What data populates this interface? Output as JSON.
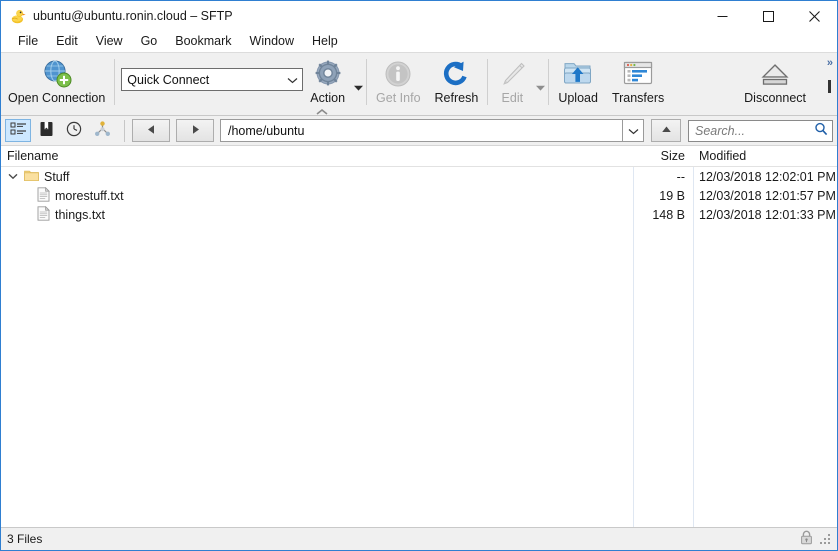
{
  "window": {
    "title": "ubuntu@ubuntu.ronin.cloud – SFTP",
    "app_icon": "duck-icon",
    "accent_color": "#2f7fd1",
    "controls": {
      "minimize": "minimize-icon",
      "maximize": "maximize-icon",
      "close": "close-icon"
    }
  },
  "menubar": {
    "items": [
      {
        "label": "File"
      },
      {
        "label": "Edit"
      },
      {
        "label": "View"
      },
      {
        "label": "Go"
      },
      {
        "label": "Bookmark"
      },
      {
        "label": "Window"
      },
      {
        "label": "Help"
      }
    ]
  },
  "toolbar": {
    "open_connection": {
      "label": "Open Connection",
      "icon": "globe-plus-icon",
      "enabled": true
    },
    "quick_connect": {
      "value": "Quick Connect",
      "placeholder": "Quick Connect",
      "icon": "chevron-down-icon"
    },
    "action": {
      "label": "Action",
      "icon": "gear-icon",
      "enabled": true,
      "has_dropdown": true
    },
    "get_info": {
      "label": "Get Info",
      "icon": "info-icon",
      "enabled": false
    },
    "refresh": {
      "label": "Refresh",
      "icon": "refresh-icon",
      "enabled": true
    },
    "edit": {
      "label": "Edit",
      "icon": "pencil-icon",
      "enabled": false,
      "has_dropdown": true
    },
    "upload": {
      "label": "Upload",
      "icon": "upload-folder-icon",
      "enabled": true
    },
    "transfers": {
      "label": "Transfers",
      "icon": "transfers-window-icon",
      "enabled": true
    },
    "disconnect": {
      "label": "Disconnect",
      "icon": "eject-icon",
      "enabled": true
    },
    "overflow": {
      "label": "»"
    }
  },
  "navbar": {
    "view_toggles": [
      {
        "name": "browser-view",
        "icon": "list-view-icon",
        "active": true
      },
      {
        "name": "bookmarks-view",
        "icon": "bookmark-book-icon",
        "active": false
      },
      {
        "name": "history-view",
        "icon": "clock-icon",
        "active": false
      },
      {
        "name": "bonjour-view",
        "icon": "bonjour-icon",
        "active": false
      }
    ],
    "back": {
      "icon": "arrow-left-icon"
    },
    "forward": {
      "icon": "arrow-right-icon"
    },
    "path": {
      "value": "/home/ubuntu",
      "dropdown_icon": "chevron-down-icon"
    },
    "parent": {
      "icon": "arrow-up-icon"
    },
    "search": {
      "placeholder": "Search...",
      "value": "",
      "icon": "search-icon"
    }
  },
  "browser": {
    "columns": [
      {
        "key": "filename",
        "label": "Filename"
      },
      {
        "key": "size",
        "label": "Size"
      },
      {
        "key": "modified",
        "label": "Modified"
      }
    ],
    "rows": [
      {
        "name": "Stuff",
        "type": "folder",
        "icon": "folder-icon",
        "indent": 0,
        "expanded": true,
        "disclosure": "chevron-down-icon",
        "size": "--",
        "modified": "12/03/2018 12:02:01 PM"
      },
      {
        "name": "morestuff.txt",
        "type": "file",
        "icon": "document-icon",
        "indent": 1,
        "expanded": false,
        "disclosure": "",
        "size": "19 B",
        "modified": "12/03/2018 12:01:57 PM"
      },
      {
        "name": "things.txt",
        "type": "file",
        "icon": "document-icon",
        "indent": 1,
        "expanded": false,
        "disclosure": "",
        "size": "148 B",
        "modified": "12/03/2018 12:01:33 PM"
      }
    ]
  },
  "statusbar": {
    "text": "3 Files",
    "secure_icon": "padlock-icon",
    "resize_grip": "resize-grip-icon"
  }
}
